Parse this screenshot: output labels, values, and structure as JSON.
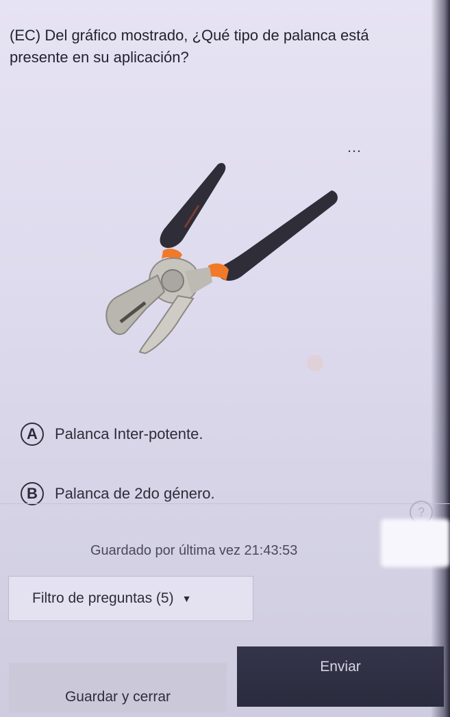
{
  "question": {
    "text": "(EC) Del gráfico mostrado, ¿Qué tipo de palanca está presente en su aplicación?"
  },
  "figure": {
    "subject": "pliers",
    "more_icon": "…"
  },
  "options": [
    {
      "letter": "A",
      "label": "Palanca Inter-potente."
    },
    {
      "letter": "B",
      "label": "Palanca de 2do género."
    }
  ],
  "help_icon": "?",
  "status": {
    "saved_text": "Guardado por última vez 21:43:53"
  },
  "filter": {
    "label": "Filtro de preguntas (5)",
    "caret": "▼"
  },
  "buttons": {
    "save_close": "Guardar y cerrar",
    "submit": "Enviar"
  },
  "colors": {
    "background": "#dedbee",
    "submit_bg": "#2f3043",
    "save_bg": "#cbc8d9",
    "accent_orange": "#f07a2a"
  }
}
